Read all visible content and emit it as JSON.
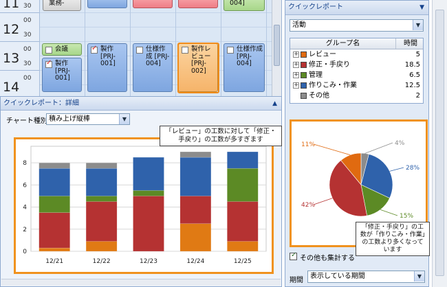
{
  "calendar": {
    "hours": [
      "11",
      "12",
      "13",
      "14"
    ],
    "minutes": [
      "30",
      "00",
      "30",
      "00",
      "30",
      "00"
    ],
    "top_row": {
      "col1_text": "業務-",
      "col5_text": "004]"
    },
    "appointments": [
      {
        "col": 1,
        "style": "green",
        "checked": false,
        "text": "会議"
      },
      {
        "col": 1,
        "style": "blue",
        "checked": true,
        "text": "製作 [PRJ-001]"
      },
      {
        "col": 2,
        "style": "blue",
        "checked": true,
        "text": "製作 [PRJ-001]"
      },
      {
        "col": 3,
        "style": "blue",
        "checked": false,
        "text": "仕様作成 [PRJ-004]"
      },
      {
        "col": 4,
        "style": "orange",
        "checked": false,
        "text": "製作レビュー [PRJ-002]"
      },
      {
        "col": 5,
        "style": "blue",
        "checked": false,
        "text": "仕様作成 [PRJ-004]"
      }
    ]
  },
  "detail": {
    "header": "クイックレポート：詳細",
    "chart_type_label": "チャート種別",
    "chart_type_value": "積み上げ縦棒",
    "callout": "「レビュー」の工数に対して「修正・手戻り」の工数が多すぎます"
  },
  "quick_report": {
    "header": "クイックレポート",
    "selector_value": "活動",
    "table_headers": {
      "group": "グループ名",
      "hours": "時間"
    },
    "rows": [
      {
        "name": "レビュー",
        "hours": "5",
        "color": "#e06a10"
      },
      {
        "name": "修正・手戻り",
        "hours": "18.5",
        "color": "#b53232"
      },
      {
        "name": "管理",
        "hours": "6.5",
        "color": "#5c8a25"
      },
      {
        "name": "作りこみ・作業",
        "hours": "12.5",
        "color": "#2f62ab"
      },
      {
        "name": "その他",
        "hours": "2",
        "color": "#8c8c8c"
      }
    ],
    "pie_callout": "「修正・手戻り」の工数が「作りこみ・作業」の工数より多くなっています",
    "include_others_label": "その他も集計する",
    "period_label": "期間",
    "period_value": "表示している期間"
  },
  "chart_data": [
    {
      "type": "bar",
      "stacked": true,
      "categories": [
        "12/21",
        "12/22",
        "12/23",
        "12/24",
        "12/25"
      ],
      "series": [
        {
          "color": "#e07a14",
          "values": [
            0.3,
            0.9,
            0,
            2.5,
            0.9
          ]
        },
        {
          "color": "#b53232",
          "values": [
            3.2,
            3.6,
            5.0,
            2.5,
            3.6
          ]
        },
        {
          "color": "#5c8a25",
          "values": [
            1.5,
            0.5,
            0.5,
            0,
            3.0
          ]
        },
        {
          "color": "#2f62ab",
          "values": [
            2.5,
            2.5,
            3.0,
            3.5,
            1.5
          ]
        },
        {
          "color": "#8c8c8c",
          "values": [
            0.5,
            0.5,
            0,
            0.5,
            0
          ]
        }
      ],
      "yticks": [
        "0",
        "2",
        "4",
        "6",
        "8"
      ],
      "ylim": [
        0,
        9.5
      ]
    },
    {
      "type": "pie",
      "slices": [
        {
          "name": "その他",
          "value": 4,
          "label": "4%",
          "color": "#8c8c8c"
        },
        {
          "name": "作りこみ・作業",
          "value": 28,
          "label": "28%",
          "color": "#2f62ab"
        },
        {
          "name": "管理",
          "value": 15,
          "label": "15%",
          "color": "#5c8a25"
        },
        {
          "name": "修正・手戻り",
          "value": 42,
          "label": "42%",
          "color": "#b53232"
        },
        {
          "name": "レビュー",
          "value": 11,
          "label": "11%",
          "color": "#e06a10"
        }
      ]
    }
  ]
}
